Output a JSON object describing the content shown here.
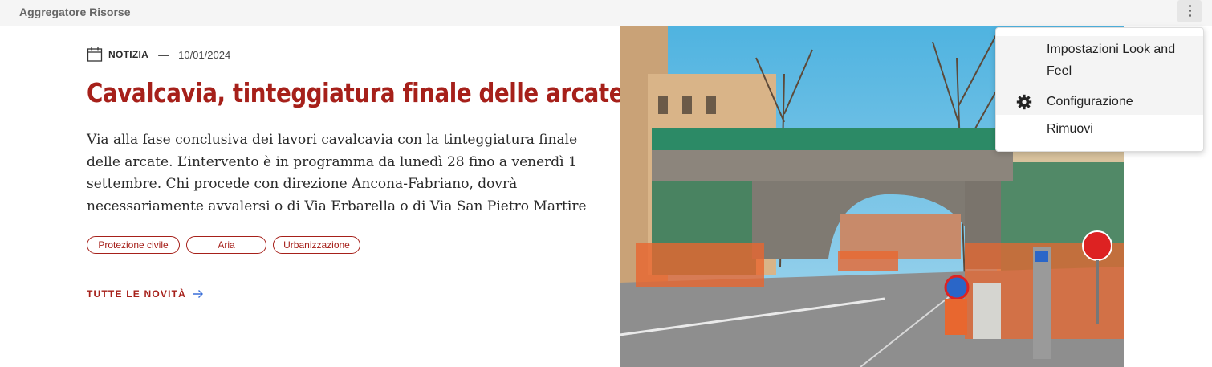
{
  "portlet": {
    "title": "Aggregatore Risorse",
    "options_icon": "kebab-vertical-icon"
  },
  "article": {
    "category_icon": "calendar-icon",
    "category": "NOTIZIA",
    "separator": "—",
    "date": "10/01/2024",
    "title": "Cavalcavia, tinteggiatura finale delle arcate",
    "description": "Via alla fase conclusiva dei lavori cavalcavia con la tinteggiatura finale delle arcate. L’intervento è in programma da lunedì 28 fino a venerdì 1 settembre. Chi procede con direzione Ancona-Fabriano, dovrà necessariamente avvalersi o di Via Erbarella o di Via San Pietro Martire",
    "tags": [
      "Protezione civile",
      "Aria",
      "Urbanizzazione"
    ],
    "all_news_label": "TUTTE LE NOVITÀ",
    "all_news_icon": "arrow-right-icon"
  },
  "dropdown_menu": {
    "items": [
      {
        "label": "Impostazioni Look and Feel",
        "icon": ""
      },
      {
        "label": "Configurazione",
        "icon": "gear-icon"
      },
      {
        "label": "Rimuovi",
        "icon": ""
      }
    ]
  },
  "colors": {
    "accent": "#a6201a",
    "topbar_bg": "#f5f5f5",
    "text": "#2a2a2a"
  }
}
